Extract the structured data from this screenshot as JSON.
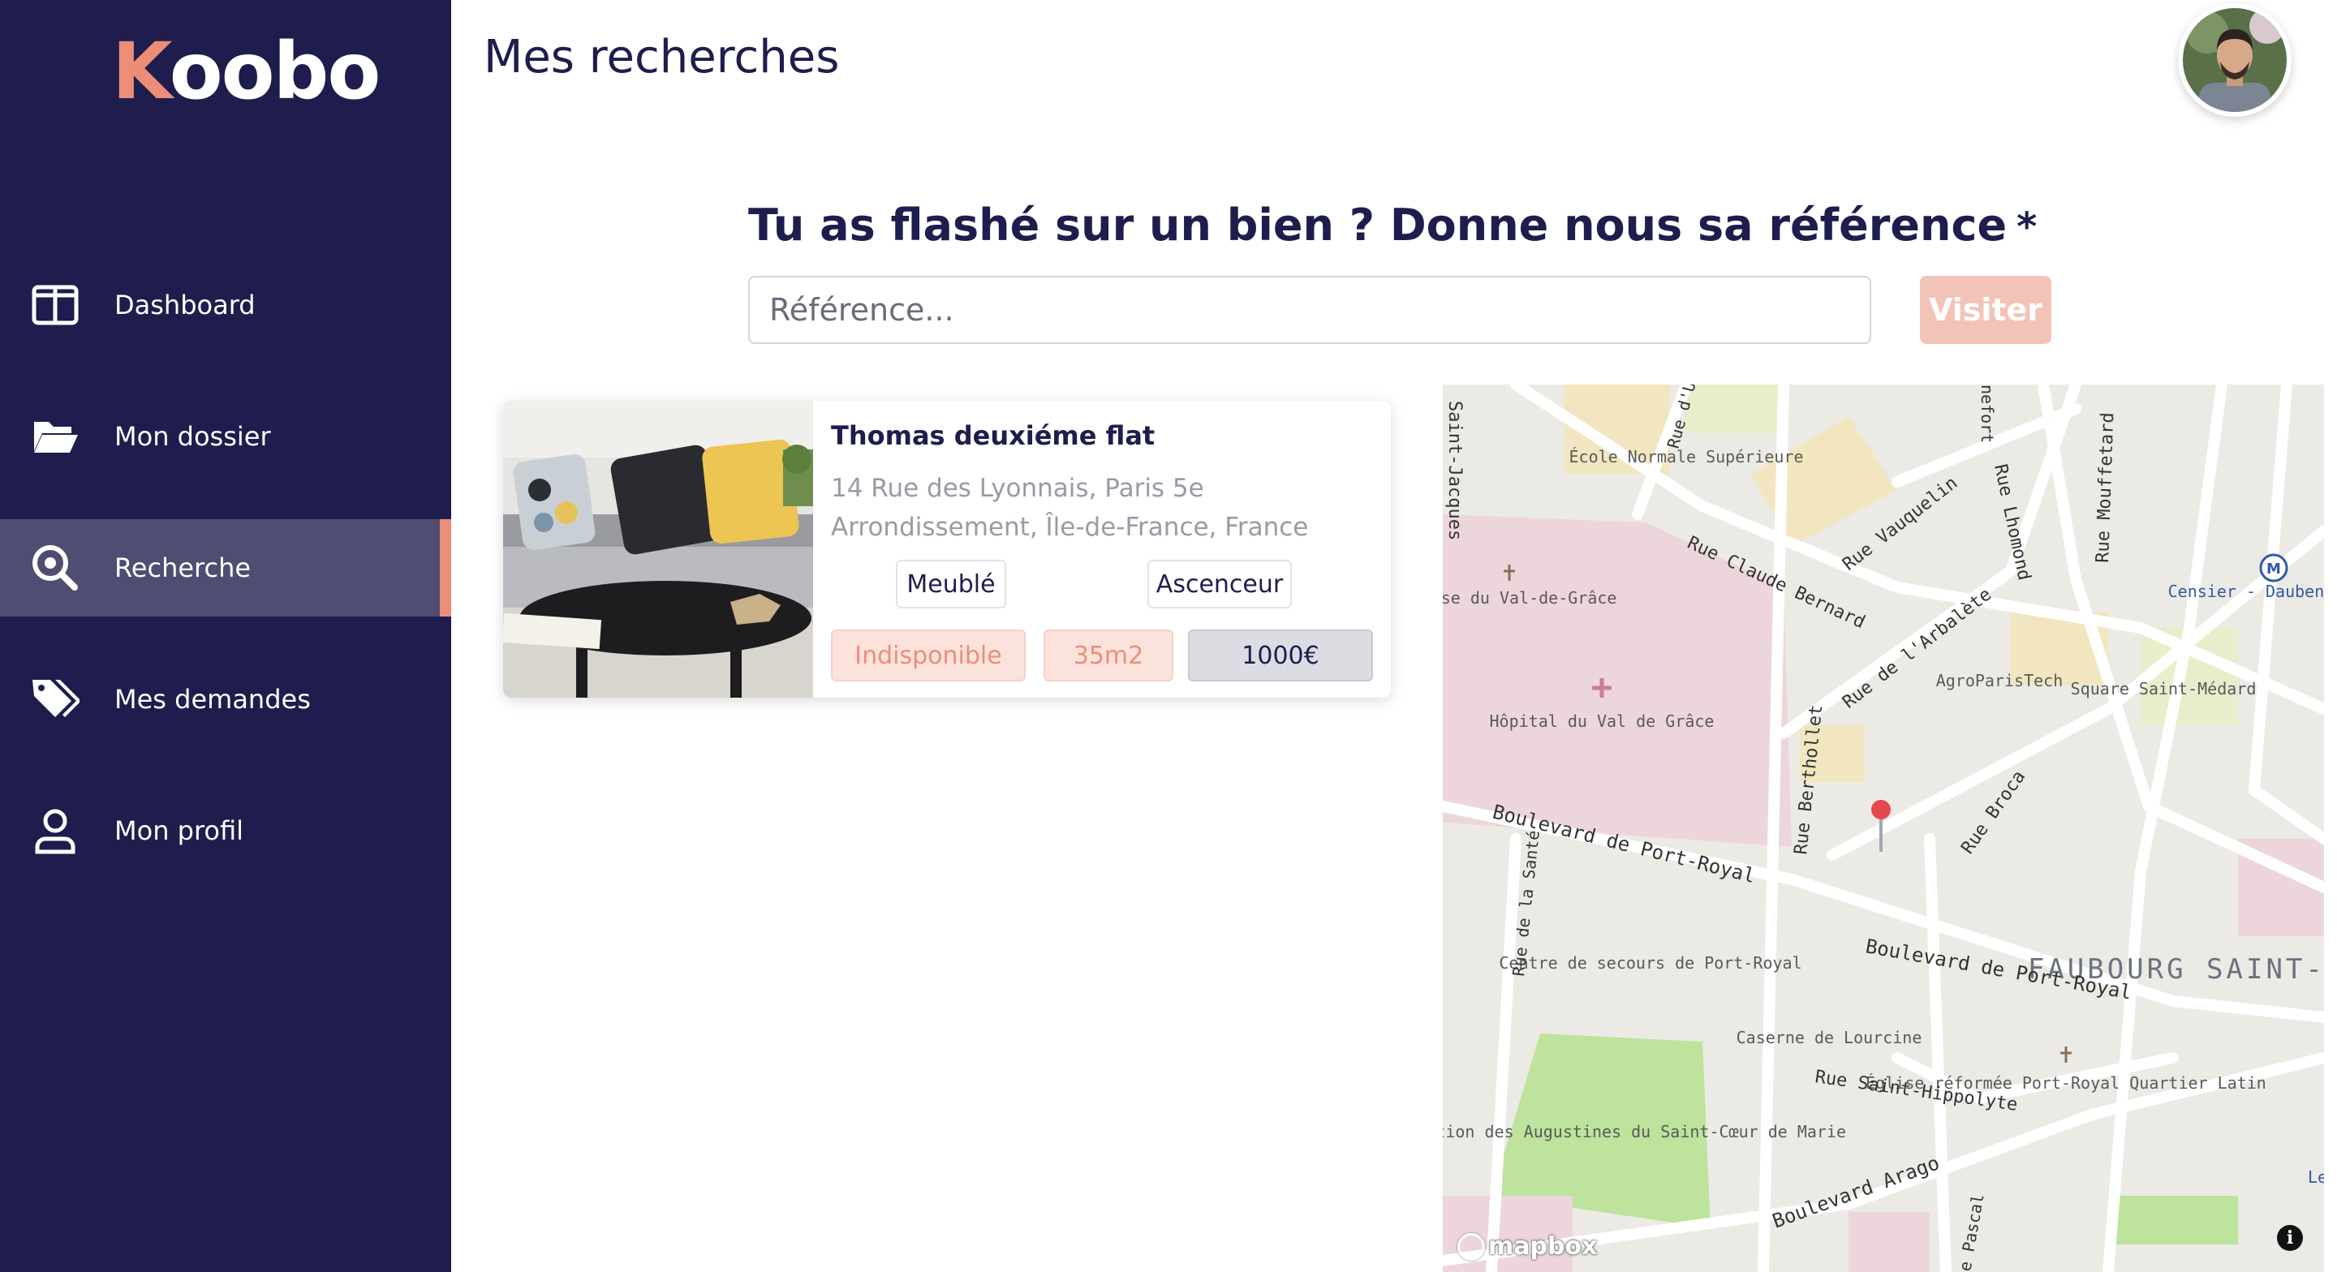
{
  "brand": {
    "logo_first": "K",
    "logo_rest": "oobo",
    "accent": "#ee8d77",
    "sidebar_bg": "#1f1d4d"
  },
  "sidebar": {
    "items": [
      {
        "label": "Dashboard",
        "icon": "dashboard-icon",
        "active": false
      },
      {
        "label": "Mon dossier",
        "icon": "folder-icon",
        "active": false
      },
      {
        "label": "Recherche",
        "icon": "search-icon",
        "active": true
      },
      {
        "label": "Mes demandes",
        "icon": "tags-icon",
        "active": false
      },
      {
        "label": "Mon profil",
        "icon": "user-icon",
        "active": false
      }
    ]
  },
  "header": {
    "title": "Mes recherches",
    "avatar": "user-avatar"
  },
  "reference": {
    "title": "Tu as flashé sur un bien ? Donne nous sa référence",
    "required_marker": "*",
    "placeholder": "Référence...",
    "value": "",
    "button_label": "Visiter"
  },
  "listing": {
    "title": "Thomas deuxiéme flat",
    "address": "14 Rue des Lyonnais, Paris 5e Arrondissement, Île-de-France, France",
    "features": [
      "Meublé",
      "Ascenceur"
    ],
    "status": "Indisponible",
    "surface": "35m2",
    "price": "1000€"
  },
  "map": {
    "labels": {
      "ecole": "École Normale Supérieure",
      "eglise_val": "Église du Val-de-Grâce",
      "hopital": "Hôpital du Val de Grâce",
      "agro": "AgroParisTech",
      "square": "Square Saint-Médard",
      "censier": "Censier - Daubenton",
      "centre_secours": "Centre de secours de Port-Royal",
      "caserne": "Caserne de Lourcine",
      "eglise_reformee": "Église réformée Port-Royal Quartier Latin",
      "congregation": "Congrégation des Augustines du Saint-Cœur de Marie",
      "faubourg": "FAUBOURG SAINT-MARCEAU",
      "les": "Les",
      "rue_claude_bernard": "Rue Claude Bernard",
      "rue_vauquelin": "Rue Vauquelin",
      "rue_arbalete": "Rue de l'Arbalète",
      "rue_lhomond": "Rue Lhomond",
      "rue_mouffetard": "Rue Mouffetard",
      "rue_berthollet": "Rue Berthollet",
      "rue_broca": "Rue Broca",
      "bd_port_royal_1": "Boulevard de Port-Royal",
      "bd_port_royal_2": "Boulevard de Port-Royal",
      "rue_sante": "Rue de la Santé",
      "rue_st_hippolyte": "Rue Saint-Hippolyte",
      "bd_arago": "Boulevard Arago",
      "rue_st_jacques": "Saint-Jacques",
      "rue_ulm": "Rue d'Ulm",
      "rue_pascal": "e Pascal",
      "rue_tournefort": "nefort",
      "metro": "M",
      "attribution": "mapbox"
    }
  }
}
